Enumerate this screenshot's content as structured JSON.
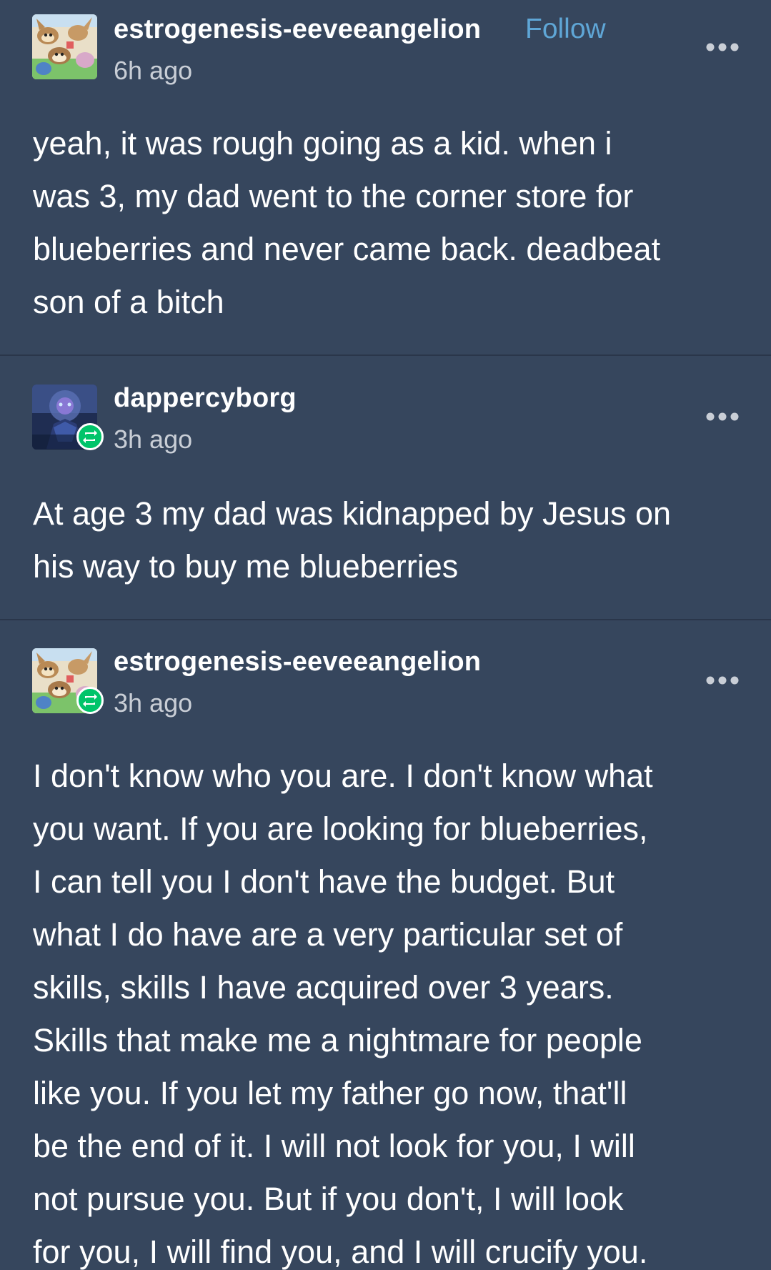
{
  "colors": {
    "background": "#36465d",
    "divider": "#2a364a",
    "follow_link": "#5fa6d6",
    "reblog_badge": "#00c46a",
    "timestamp": "#c9ced6"
  },
  "posts": [
    {
      "username": "estrogenesis-eeveeangelion",
      "follow_label": "Follow",
      "timestamp": "6h ago",
      "avatar_icon": "eevee-collage-avatar",
      "reblog": false,
      "more_icon": "more-options-icon",
      "body_lines": [
        "yeah, it was rough going as a kid. when i",
        "was 3, my dad went to the corner store for",
        "blueberries and never came back. deadbeat",
        "son of a bitch"
      ]
    },
    {
      "username": "dappercyborg",
      "timestamp": "3h ago",
      "avatar_icon": "dark-blue-creature-avatar",
      "reblog": true,
      "reblog_icon": "reblog-icon",
      "more_icon": "more-options-icon",
      "body_lines": [
        "At age 3 my dad was kidnapped by Jesus on",
        "his way to buy me blueberries"
      ]
    },
    {
      "username": "estrogenesis-eeveeangelion",
      "timestamp": "3h ago",
      "avatar_icon": "eevee-collage-avatar",
      "reblog": true,
      "reblog_icon": "reblog-icon",
      "more_icon": "more-options-icon",
      "body_lines": [
        "I don't know who you are. I don't know what",
        "you want. If you are looking for blueberries,",
        "I can tell you I don't have the budget. But",
        "what I do have are a very particular set of",
        "skills, skills I have acquired over 3 years.",
        "Skills that make me a nightmare for people",
        "like you. If you let my father go now, that'll",
        "be the end of it. I will not look for you, I will",
        "not pursue you. But if you don't, I will look",
        "for you, I will find you, and I will crucify you."
      ]
    }
  ]
}
